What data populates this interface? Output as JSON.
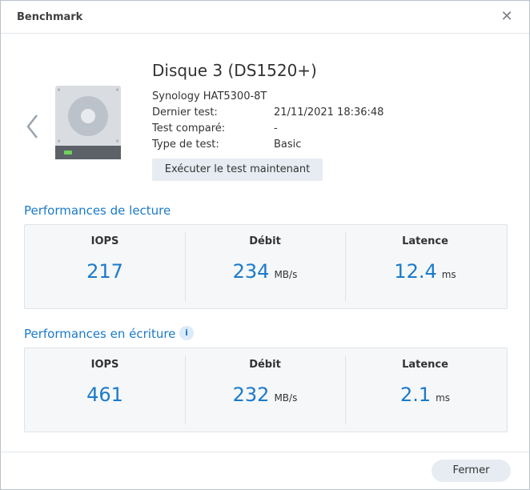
{
  "window": {
    "title": "Benchmark",
    "close_icon": "close-icon"
  },
  "disk": {
    "name": "Disque 3 (DS1520+)",
    "model": "Synology HAT5300-8T",
    "rows": [
      {
        "label": "Dernier test:",
        "value": "21/11/2021 18:36:48"
      },
      {
        "label": "Test comparé:",
        "value": "-"
      },
      {
        "label": "Type de test:",
        "value": "Basic"
      }
    ],
    "run_button": "Exécuter le test maintenant"
  },
  "read": {
    "title": "Performances de lecture",
    "iops": {
      "label": "IOPS",
      "value": "217"
    },
    "throughput": {
      "label": "Débit",
      "value": "234",
      "unit": "MB/s"
    },
    "latency": {
      "label": "Latence",
      "value": "12.4",
      "unit": "ms"
    }
  },
  "write": {
    "title": "Performances en écriture",
    "info_icon": "i",
    "iops": {
      "label": "IOPS",
      "value": "461"
    },
    "throughput": {
      "label": "Débit",
      "value": "232",
      "unit": "MB/s"
    },
    "latency": {
      "label": "Latence",
      "value": "2.1",
      "unit": "ms"
    }
  },
  "footer": {
    "close_button": "Fermer"
  },
  "colors": {
    "accent": "#1b7ac9",
    "panel": "#f5f7f9",
    "button": "#e7ecf2",
    "led": "#6fd05a"
  }
}
